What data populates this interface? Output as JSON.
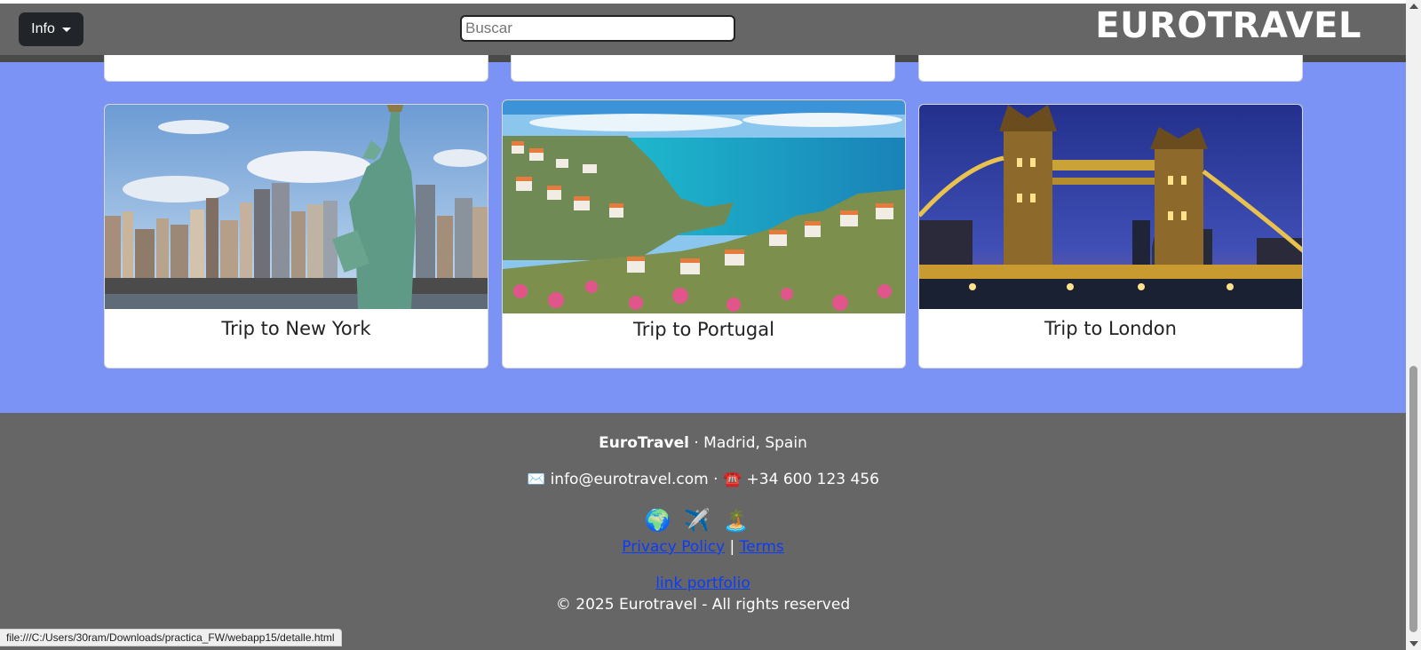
{
  "navbar": {
    "info_label": "Info",
    "search_placeholder": "Buscar",
    "brand": "EUROTRAVEL"
  },
  "cards": [
    {
      "title": "Trip to New York"
    },
    {
      "title": "Trip to Portugal"
    },
    {
      "title": "Trip to London"
    }
  ],
  "footer": {
    "company": "EuroTravel",
    "location": " · Madrid, Spain",
    "mail_icon": "✉️",
    "email": "info@eurotravel.com",
    "separator": " · ",
    "phone_icon": "☎️",
    "phone": "+34 600 123 456",
    "icons": [
      "🌍",
      "✈️",
      "🏝️"
    ],
    "privacy": "Privacy Policy",
    "pipe": " | ",
    "terms": "Terms",
    "portfolio": "link portfolio",
    "copyright": "© 2025 Eurotravel - All rights reserved"
  },
  "status_url": "file:///C:/Users/30ram/Downloads/practica_FW/webapp15/detalle.html"
}
